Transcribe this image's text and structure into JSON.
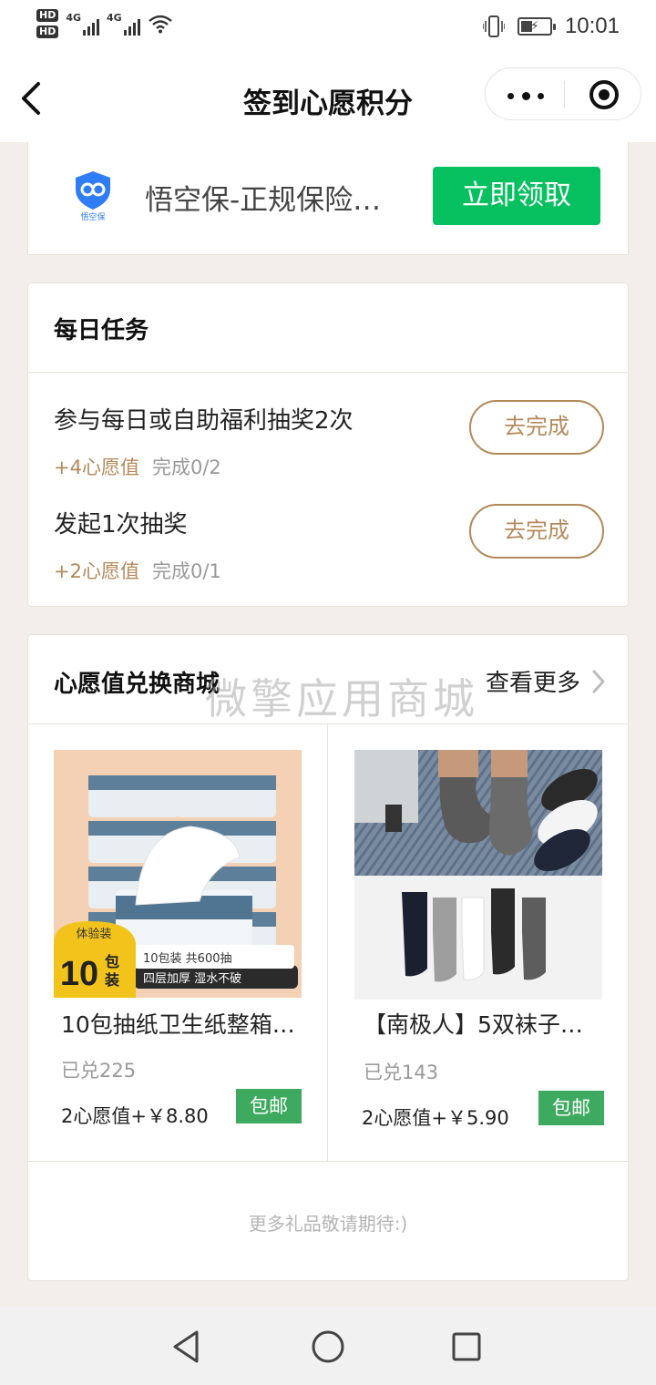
{
  "status_bar": {
    "sim1": "HD",
    "sim2": "HD",
    "net1": "4G",
    "net2": "4G",
    "time": "10:01",
    "icons": [
      "signal-icon",
      "wifi-icon",
      "vibrate-icon",
      "battery-charging-icon"
    ]
  },
  "nav": {
    "title": "签到心愿积分",
    "icons": [
      "back-arrow-icon",
      "more-dots-icon",
      "close-target-icon"
    ]
  },
  "ad": {
    "logo_text": "悟空保",
    "title": "悟空保-正规保险…",
    "button_label": "立即领取",
    "accent": "#07c160"
  },
  "daily_tasks": {
    "heading": "每日任务",
    "items": [
      {
        "title": "参与每日或自助福利抽奖2次",
        "reward": "+4心愿值",
        "progress": "完成0/2",
        "button_label": "去完成"
      },
      {
        "title": "发起1次抽奖",
        "reward": "+2心愿值",
        "progress": "完成0/1",
        "button_label": "去完成"
      }
    ]
  },
  "shop": {
    "heading": "心愿值兑换商城",
    "more_label": "查看更多",
    "watermark": "微擎应用商城",
    "products": [
      {
        "name": "10包抽纸卫生纸整箱…",
        "sold": "已兑225",
        "price": "2心愿值+￥8.80",
        "badge": "包邮",
        "img_tag_small": "体验装",
        "img_tag_big": "10",
        "img_tag_unit1": "包",
        "img_tag_unit2": "装",
        "img_line1": "10包装 共600抽",
        "img_line2": "四层加厚 湿水不破"
      },
      {
        "name": "【南极人】5双袜子…",
        "sold": "已兑143",
        "price": "2心愿值+￥5.90",
        "badge": "包邮"
      }
    ],
    "footer_note": "更多礼品敬请期待:)"
  },
  "system_nav": {
    "icons": [
      "nav-back-icon",
      "nav-home-icon",
      "nav-recents-icon"
    ]
  }
}
